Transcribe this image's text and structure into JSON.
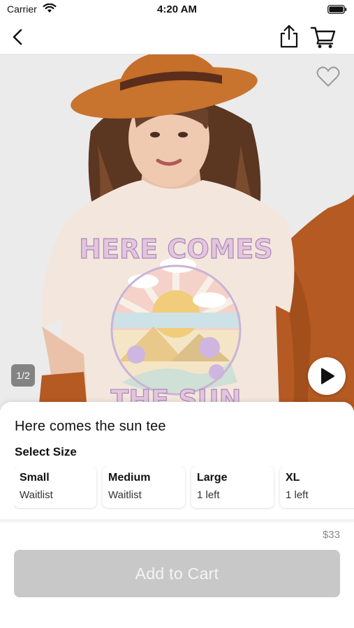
{
  "status_bar": {
    "carrier": "Carrier",
    "time": "4:20 AM"
  },
  "nav": {
    "back_icon": "chevron-left-icon",
    "share_icon": "share-icon",
    "cart_icon": "cart-icon"
  },
  "hero": {
    "image_counter": "1/2",
    "favorite_icon": "heart-outline-icon",
    "play_icon": "play-icon",
    "shirt_print_text": [
      "HERE COMES",
      "THE SUN"
    ]
  },
  "product": {
    "title": "Here comes the sun tee",
    "size_heading": "Select Size",
    "sizes": [
      {
        "name": "Small",
        "stock": "Waitlist"
      },
      {
        "name": "Medium",
        "stock": "Waitlist"
      },
      {
        "name": "Large",
        "stock": "1 left"
      },
      {
        "name": "XL",
        "stock": "1 left"
      }
    ]
  },
  "footer": {
    "price": "$33",
    "add_to_cart_label": "Add to Cart"
  },
  "colors": {
    "button_disabled": "#c8c8c8",
    "hat": "#c8742e",
    "shirt": "#f3e6dc",
    "jacket": "#b45a22"
  }
}
